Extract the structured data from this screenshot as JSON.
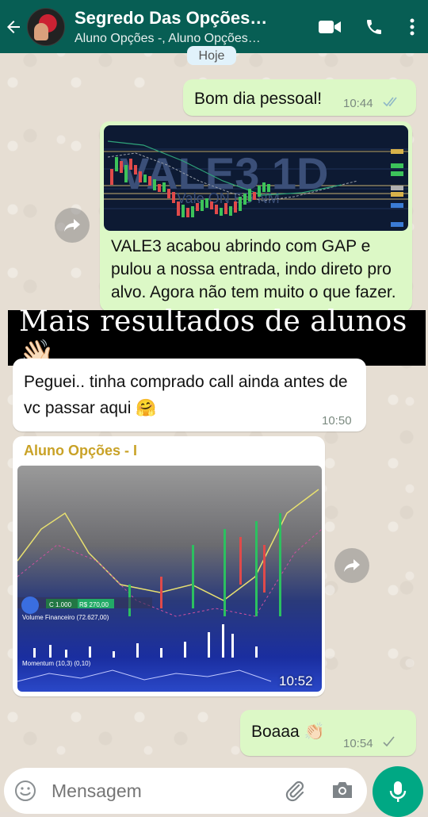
{
  "header": {
    "title": "Segredo Das Opções…",
    "subtitle": "Aluno Opções -, Aluno Opções…"
  },
  "date_chip": "Hoje",
  "messages": {
    "m1": {
      "text": "Bom dia pessoal!",
      "time": "10:44",
      "status": "read"
    },
    "m2": {
      "chart_title": "VALE3 1D",
      "chart_subtitle": "Vale ON ED NM",
      "text": "VALE3 acabou abrindo com GAP e pulou a nossa entrada, indo direto pro alvo. Agora não tem muito o que fazer."
    },
    "m3": {
      "text": "Peguei.. tinha comprado call ainda antes de vc passar aqui 🤗",
      "time": "10:50"
    },
    "m4": {
      "sender": "Aluno Opções - I",
      "time": "10:52",
      "photo_labels": {
        "price_box": "R$ 270,00",
        "qty": "C 1.000",
        "volume": "Volume Financeiro (72.627,00)",
        "momentum": "Momentum (10,3) (0,10)"
      }
    },
    "m5": {
      "text": "Boaaa 👏🏻",
      "time": "10:54",
      "status": "sent"
    }
  },
  "banner": {
    "text": "Mais resultados de alunos 👋🏻"
  },
  "input": {
    "placeholder": "Mensagem"
  },
  "colors": {
    "header": "#075e54",
    "outgoing": "#dcf8c6",
    "incoming": "#ffffff",
    "mic": "#00a884",
    "sender_name": "#c9a227"
  }
}
